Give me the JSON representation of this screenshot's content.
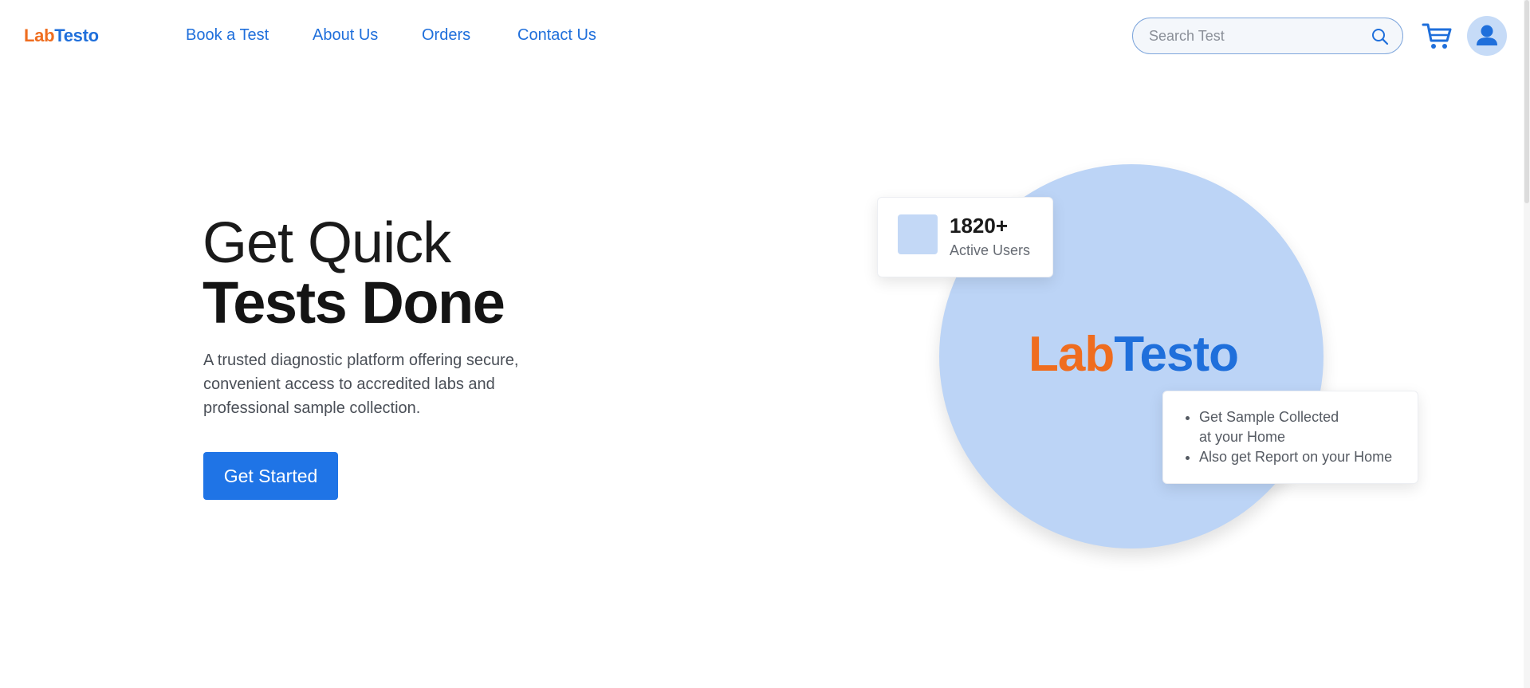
{
  "header": {
    "logo": {
      "lab": "Lab",
      "testo": "Testo"
    },
    "nav": [
      {
        "label": "Book a Test"
      },
      {
        "label": "About Us"
      },
      {
        "label": "Orders"
      },
      {
        "label": "Contact Us"
      }
    ],
    "search": {
      "placeholder": "Search Test",
      "value": ""
    },
    "icons": {
      "search": "search-icon",
      "cart": "cart-icon",
      "user": "user-icon"
    }
  },
  "hero": {
    "title_line1": "Get Quick",
    "title_line2": "Tests Done",
    "description": "A trusted diagnostic platform offering secure, convenient access to accredited labs and professional sample collection.",
    "cta_label": "Get Started"
  },
  "visual": {
    "logo": {
      "lab": "Lab",
      "testo": "Testo"
    },
    "stats": {
      "value": "1820+",
      "label": "Active Users"
    },
    "features": [
      {
        "line1": "Get Sample Collected",
        "line2": "at your Home"
      },
      {
        "line1": "Also get Report on your Home",
        "line2": ""
      }
    ]
  },
  "colors": {
    "brand_orange": "#ef6d1f",
    "brand_blue": "#1f6fdb",
    "cta_blue": "#1f74e6",
    "circle_blue": "#bcd4f6"
  }
}
